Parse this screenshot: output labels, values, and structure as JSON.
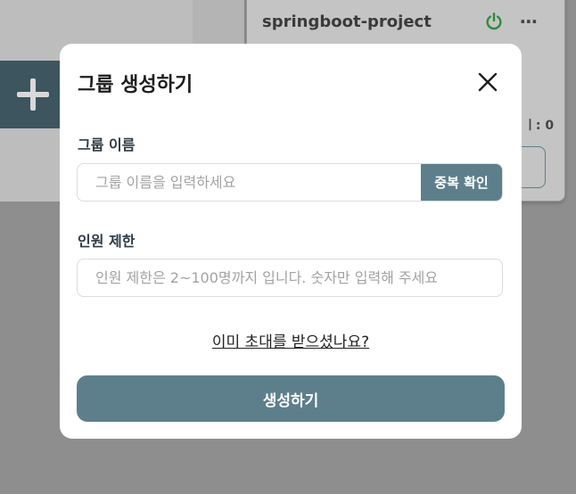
{
  "background": {
    "project_title": "springboot-project",
    "count_text": "ㅣ: 0",
    "power_icon": "power-icon",
    "more_icon": "more-horizontal-icon",
    "add_icon": "plus-icon"
  },
  "modal": {
    "title": "그룹 생성하기",
    "close_icon": "close-icon",
    "name_label": "그룹 이름",
    "name_placeholder": "그룹 이름을 입력하세요",
    "dup_check_label": "중복 확인",
    "limit_label": "인원 제한",
    "limit_placeholder": "인원 제한은 2~100명까지 입니다. 숫자만 입력해 주세요",
    "invite_link": "이미 초대를 받으셨나요?",
    "create_label": "생성하기"
  },
  "colors": {
    "accent": "#5d7f8c",
    "overlay": "#8e8e8e",
    "power_green": "#2e8b3a"
  }
}
